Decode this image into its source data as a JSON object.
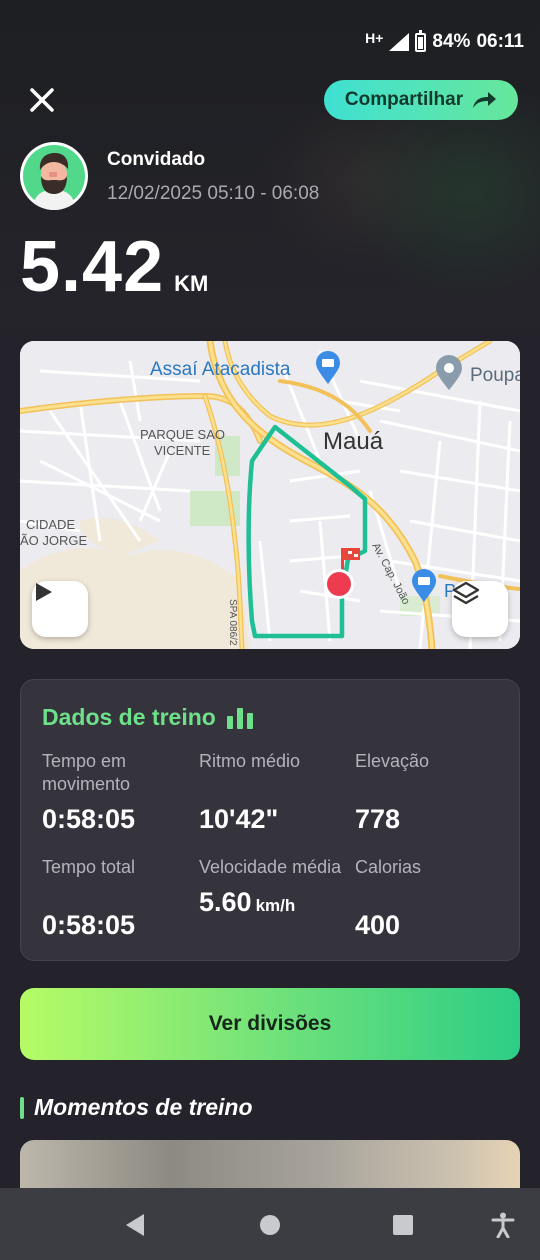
{
  "status_bar": {
    "network": "H+",
    "battery": "84%",
    "time": "06:11"
  },
  "header": {
    "share_label": "Compartilhar"
  },
  "user": {
    "name": "Convidado",
    "datetime": "12/02/2025 05:10 - 06:08"
  },
  "distance": {
    "value": "5.42",
    "unit": "KM"
  },
  "map": {
    "labels": {
      "assai": "Assaí Atacadista",
      "poupa": "Poupa",
      "maua": "Mauá",
      "parque_line1": "PARQUE SAO",
      "parque_line2": "VICENTE",
      "cidade_line1": "CIDADE",
      "cidade_line2": "ÃO JORGE",
      "avenue": "Av. Cap. João",
      "road": "SPA 086/2",
      "pa": "P A"
    }
  },
  "workout_data": {
    "title": "Dados de treino",
    "stats": [
      {
        "label": "Tempo em movimento",
        "value": "0:58:05",
        "unit": ""
      },
      {
        "label": "Ritmo médio",
        "value": "10'42\"",
        "unit": ""
      },
      {
        "label": "Elevação",
        "value": "778",
        "unit": ""
      },
      {
        "label": "Tempo total",
        "value": "0:58:05",
        "unit": ""
      },
      {
        "label": "Velocidade média",
        "value": "5.60",
        "unit": "km/h"
      },
      {
        "label": "Calorias",
        "value": "400",
        "unit": ""
      }
    ]
  },
  "splits_button": "Ver divisões",
  "moments": {
    "title": "Momentos de treino"
  },
  "colors": {
    "accent_green": "#6fe08a",
    "route": "#1fbf95",
    "background": "#24232c",
    "card": "#35343c"
  }
}
